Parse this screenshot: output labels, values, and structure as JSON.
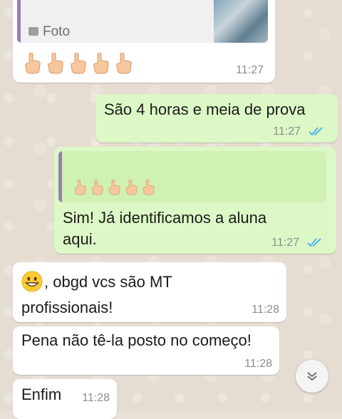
{
  "chat": {
    "messages": [
      {
        "direction": "in",
        "quoted_label": "Foto",
        "emoji_count": 5,
        "time": "11:27"
      },
      {
        "direction": "out",
        "text": "São 4 horas e meia de prova",
        "time": "11:27"
      },
      {
        "direction": "out",
        "quoted_emoji_count": 5,
        "text_line1": "Sim! Já identificamos a aluna",
        "text_line2": "aqui.",
        "time": "11:27"
      },
      {
        "direction": "in",
        "text_line1": ", obgd vcs são MT",
        "text_line2": "profissionais!",
        "time": "11:28"
      },
      {
        "direction": "in",
        "text": "Pena não tê-la posto no começo!",
        "time": "11:28"
      },
      {
        "direction": "in",
        "text": "Enfim",
        "time": "11:28"
      }
    ]
  },
  "colors": {
    "incoming_bubble": "#ffffff",
    "outgoing_bubble": "#dcf8c6",
    "read_ticks": "#4fb6ec",
    "quote_bar": "#9c7cb5"
  },
  "icons": {
    "photo": "photo-icon",
    "pointing_hand": "pointing-up-hand-icon",
    "double_check": "double-check-icon",
    "smile": "grinning-face-icon",
    "scroll_down": "chevron-down-icon"
  }
}
